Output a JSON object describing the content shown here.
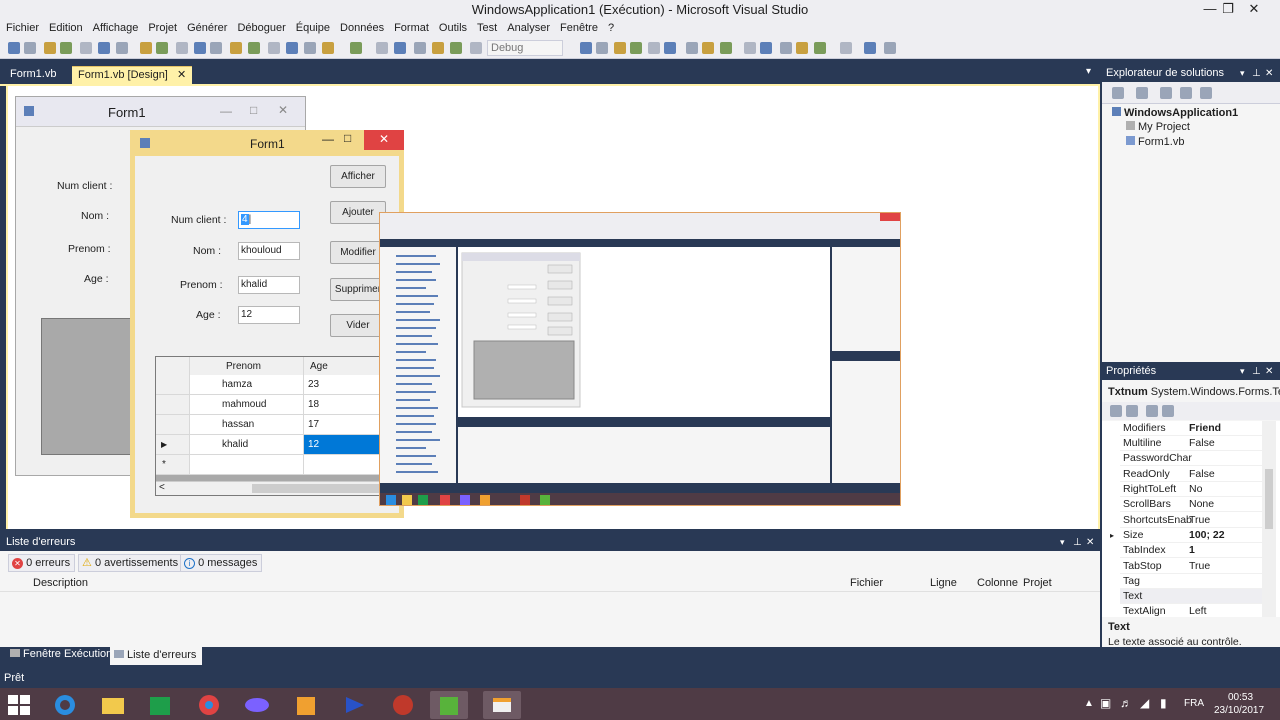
{
  "window": {
    "title": "WindowsApplication1 (Exécution) - Microsoft Visual Studio"
  },
  "menu": [
    "Fichier",
    "Edition",
    "Affichage",
    "Projet",
    "Générer",
    "Déboguer",
    "Équipe",
    "Données",
    "Format",
    "Outils",
    "Test",
    "Analyser",
    "Fenêtre",
    "?"
  ],
  "toolbar": {
    "config": "Debug"
  },
  "tabs": {
    "tab1": "Form1.vb",
    "tab2": "Form1.vb [Design]",
    "close": "✕"
  },
  "design_form": {
    "title": "Form1",
    "labels": [
      "Num client :",
      "Nom :",
      "Prenom :",
      "Age :"
    ]
  },
  "run_form": {
    "title": "Form1",
    "labels": [
      "Num client :",
      "Nom :",
      "Prenom :",
      "Age :"
    ],
    "inputs": [
      "4",
      "khouloud",
      "khalid",
      "12"
    ],
    "buttons": [
      "Afficher",
      "Ajouter",
      "Modifier",
      "Supprimer",
      "Vider"
    ],
    "grid": {
      "headers": [
        "Prenom",
        "Age"
      ],
      "rows": [
        {
          "prenom": "hamza",
          "age": "23"
        },
        {
          "prenom": "mahmoud",
          "age": "18"
        },
        {
          "prenom": "hassan",
          "age": "17"
        },
        {
          "prenom": "khalid",
          "age": "12"
        }
      ],
      "current_marker": "▶",
      "new_marker": "*",
      "scroll_left": "<"
    }
  },
  "solution_explorer": {
    "title": "Explorateur de solutions",
    "items": [
      "WindowsApplication1",
      "My Project",
      "Form1.vb"
    ]
  },
  "properties": {
    "title": "Propriétés",
    "object": "Txtnum",
    "type": "System.Windows.Forms.Te",
    "rows": [
      {
        "k": "Modifiers",
        "v": "Friend"
      },
      {
        "k": "Multiline",
        "v": "False"
      },
      {
        "k": "PasswordChar",
        "v": ""
      },
      {
        "k": "ReadOnly",
        "v": "False"
      },
      {
        "k": "RightToLeft",
        "v": "No"
      },
      {
        "k": "ScrollBars",
        "v": "None"
      },
      {
        "k": "ShortcutsEnab",
        "v": "True"
      },
      {
        "k": "Size",
        "v": "100; 22"
      },
      {
        "k": "TabIndex",
        "v": "1"
      },
      {
        "k": "TabStop",
        "v": "True"
      },
      {
        "k": "Tag",
        "v": ""
      },
      {
        "k": "Text",
        "v": ""
      },
      {
        "k": "TextAlign",
        "v": "Left"
      }
    ],
    "desc_title": "Text",
    "desc": "Le texte associé au contrôle."
  },
  "error_list": {
    "title": "Liste d'erreurs",
    "errors": "0 erreurs",
    "warnings": "0 avertissements",
    "messages": "0 messages",
    "columns": [
      "Description",
      "Fichier",
      "Ligne",
      "Colonne",
      "Projet"
    ]
  },
  "bottom_tabs": [
    "Fenêtre Exécution",
    "Liste d'erreurs"
  ],
  "status": "Prêt",
  "taskbar": {
    "time": "00:53",
    "date": "23/10/2017",
    "lang": "FRA"
  },
  "colors": {
    "vs_dark": "#293955",
    "accent_yellow": "#fff1a8",
    "selection": "#0078d7"
  }
}
